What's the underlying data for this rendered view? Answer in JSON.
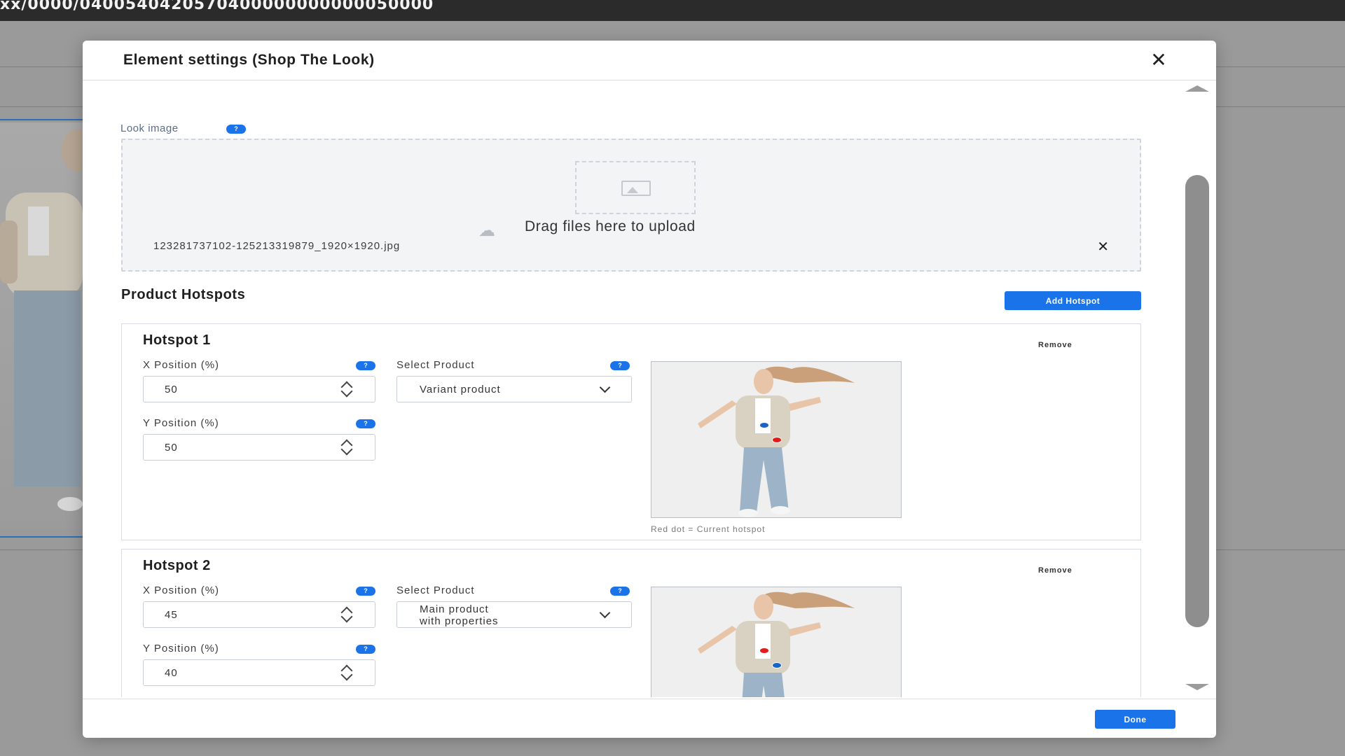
{
  "browser": {
    "url_fragment": "xx/0000/0400540420570400000000000050000"
  },
  "modal": {
    "title": "Element settings (Shop The Look)",
    "close_icon": "close-icon",
    "done_label": "Done"
  },
  "look_image": {
    "label": "Look image",
    "help_icon": "help-icon",
    "dropzone_text": "Drag files here to upload",
    "file_name": "123281737102-125213319879_1920×1920.jpg",
    "remove_icon": "close-icon"
  },
  "hotspots_section": {
    "title": "Product Hotspots",
    "add_label": "Add Hotspot",
    "preview_caption": "Red dot = Current hotspot",
    "remove_label": "Remove",
    "x_label": "X Position (%)",
    "y_label": "Y Position (%)",
    "product_label": "Select Product",
    "items": [
      {
        "title": "Hotspot 1",
        "x": "50",
        "y": "50",
        "product": "Variant product"
      },
      {
        "title": "Hotspot 2",
        "x": "45",
        "y": "40",
        "product": "Main product\nwith properties"
      }
    ]
  },
  "colors": {
    "accent": "#1a73e8",
    "current_dot": "#e21b1b",
    "other_dot": "#1a63c9"
  }
}
